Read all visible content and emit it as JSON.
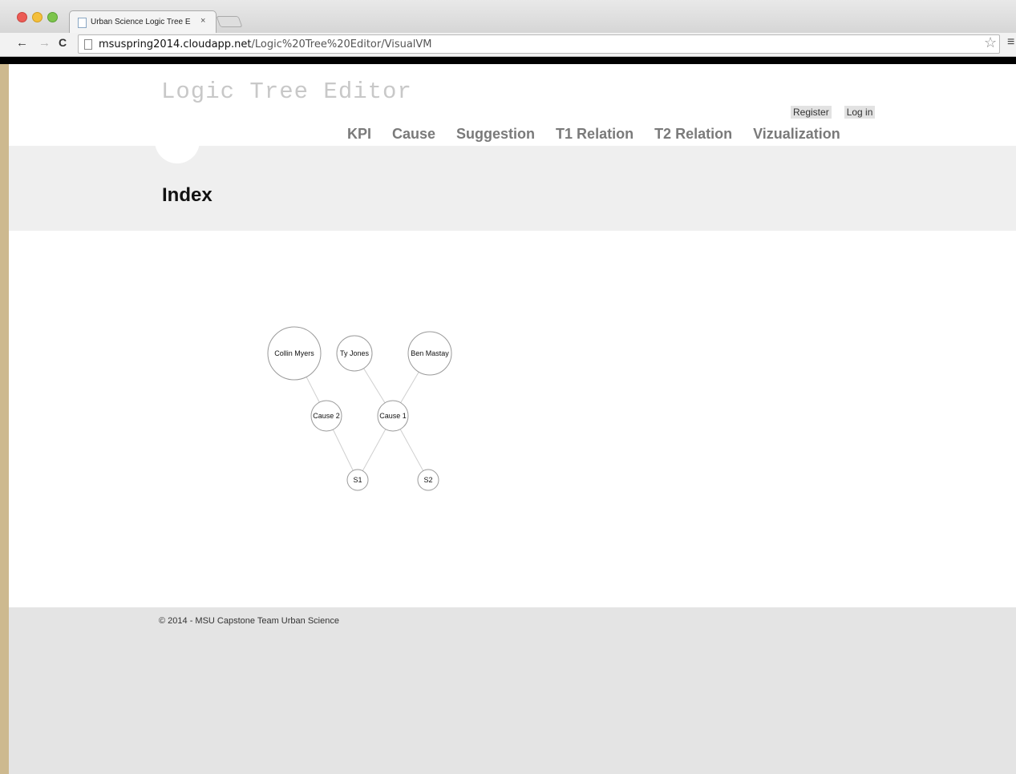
{
  "browser": {
    "tab_title": "Urban Science Logic Tree E",
    "tab_close": "×",
    "url_host": "msuspring2014.cloudapp.net",
    "url_path": "/Logic%20Tree%20Editor/VisualVM",
    "back_glyph": "←",
    "forward_glyph": "→",
    "reload_glyph": "C",
    "star_glyph": "☆",
    "menu_glyph": "≡"
  },
  "header": {
    "site_title": "Logic Tree Editor",
    "register_label": "Register",
    "login_label": "Log in"
  },
  "nav": {
    "items": [
      {
        "label": "KPI"
      },
      {
        "label": "Cause"
      },
      {
        "label": "Suggestion"
      },
      {
        "label": "T1 Relation"
      },
      {
        "label": "T2 Relation"
      },
      {
        "label": "Vizualization"
      }
    ]
  },
  "main": {
    "page_title": "Index"
  },
  "graph": {
    "nodes": [
      {
        "id": "collin",
        "label": "Collin Myers",
        "level": "top"
      },
      {
        "id": "ty",
        "label": "Ty Jones",
        "level": "top"
      },
      {
        "id": "ben",
        "label": "Ben Mastay",
        "level": "top"
      },
      {
        "id": "cause2",
        "label": "Cause 2",
        "level": "middle"
      },
      {
        "id": "cause1",
        "label": "Cause 1",
        "level": "middle"
      },
      {
        "id": "s1",
        "label": "S1",
        "level": "bottom"
      },
      {
        "id": "s2",
        "label": "S2",
        "level": "bottom"
      }
    ],
    "links": [
      {
        "source": "collin",
        "target": "cause2"
      },
      {
        "source": "ty",
        "target": "cause1"
      },
      {
        "source": "ben",
        "target": "cause1"
      },
      {
        "source": "cause2",
        "target": "s1"
      },
      {
        "source": "cause1",
        "target": "s1"
      },
      {
        "source": "cause1",
        "target": "s2"
      }
    ]
  },
  "footer": {
    "copyright": "© 2014 - MSU Capstone Team Urban Science"
  }
}
